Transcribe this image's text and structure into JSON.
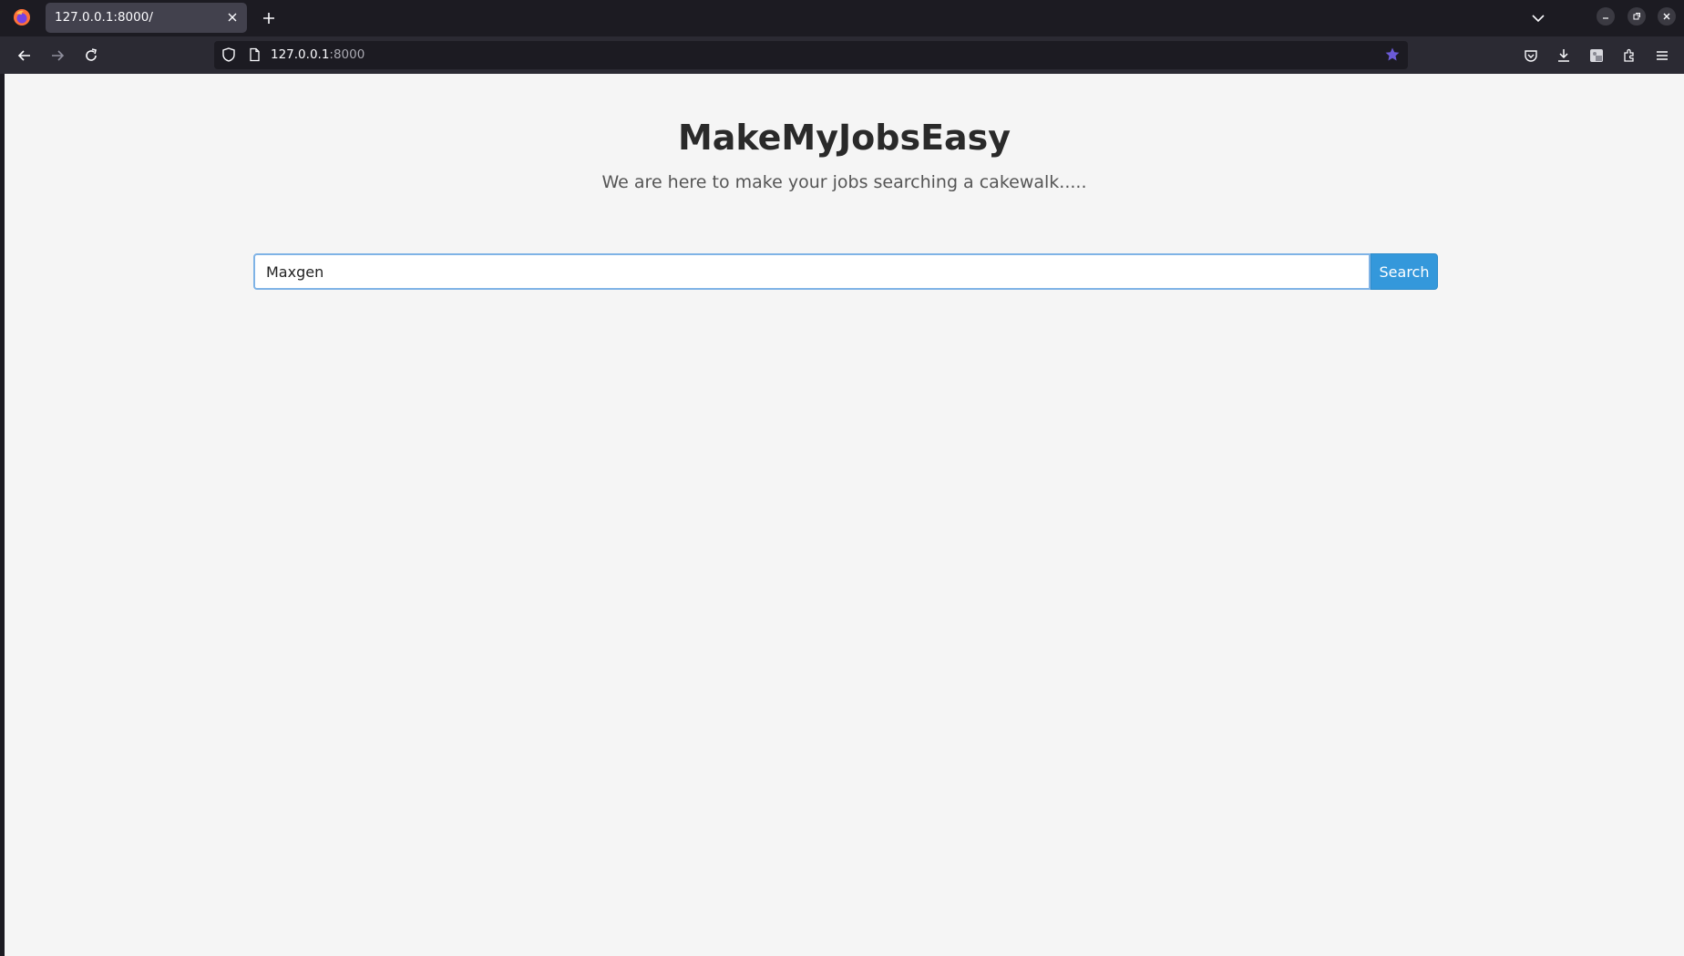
{
  "browser": {
    "tab": {
      "title": "127.0.0.1:8000/"
    },
    "url": {
      "host": "127.0.0.1",
      "port": ":8000"
    },
    "colors": {
      "accent_star": "#6b5bd7",
      "toolbar_bg": "#2b2a33",
      "tab_bg": "#42414d"
    }
  },
  "header": {
    "title": "MakeMyJobsEasy",
    "subtitle": "We are here to make your jobs searching a cakewalk....."
  },
  "search": {
    "value": "Maxgen",
    "button_label": "Search",
    "button_color": "#3498db"
  }
}
